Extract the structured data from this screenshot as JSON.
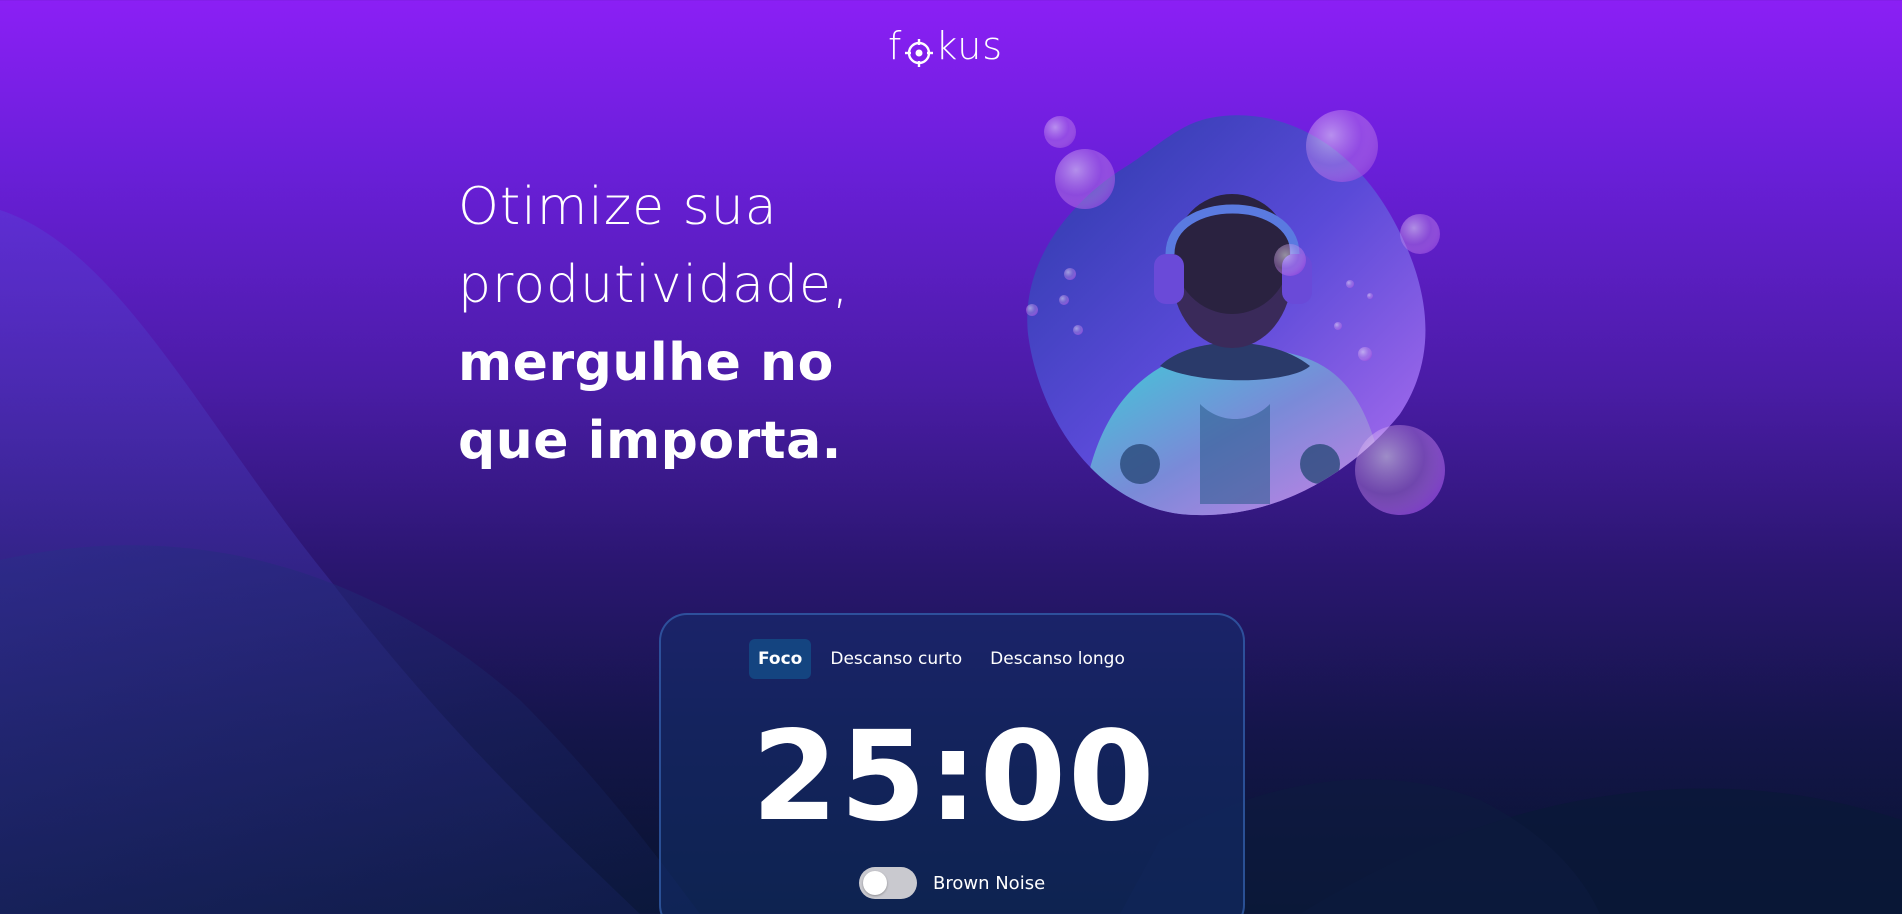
{
  "logo": {
    "prefix": "f",
    "suffix": "kus",
    "icon": "target-icon"
  },
  "headline": {
    "line1": "Otimize sua",
    "line2": "produtividade,",
    "line3": "mergulhe no",
    "line4": "que importa."
  },
  "hero_image": {
    "icon": "diver-with-headphones-illustration"
  },
  "timer_card": {
    "tabs": [
      {
        "label": "Foco",
        "active": true
      },
      {
        "label": "Descanso curto",
        "active": false
      },
      {
        "label": "Descanso longo",
        "active": false
      }
    ],
    "time": "25:00",
    "music": {
      "label": "Brown Noise",
      "enabled": false
    }
  },
  "colors": {
    "background_top": "#8b1ff5",
    "background_bottom": "#07142e",
    "active_tab": "#144480",
    "card_border": "#3c6ebe"
  }
}
